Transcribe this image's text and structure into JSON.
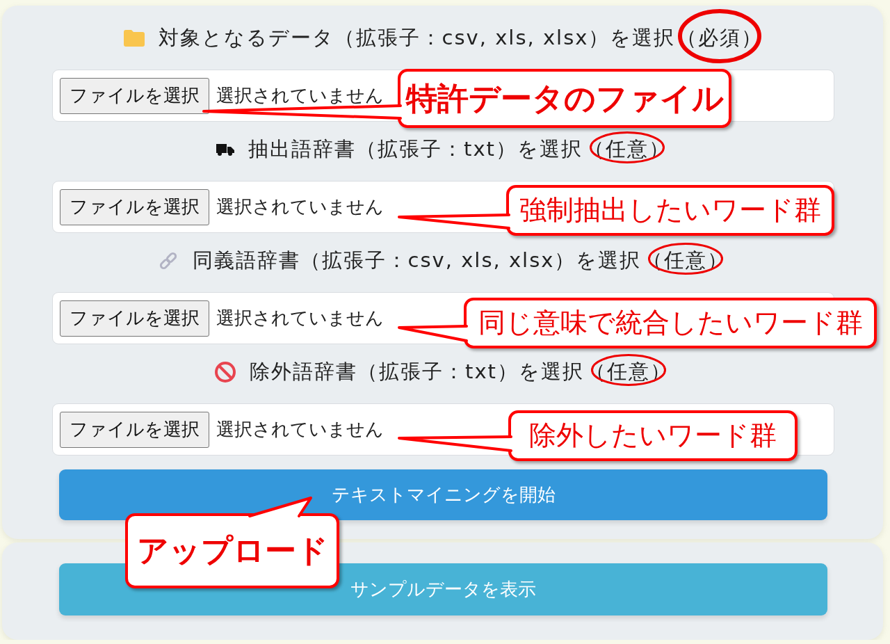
{
  "sections": [
    {
      "kind": "folder",
      "label": "対象となるデータ（拡張子：csv, xls, xlsx）を選択",
      "requirement": "（必須）",
      "circled": true,
      "file_button": "ファイルを選択",
      "file_status": "選択されていません",
      "callout": {
        "text": "特許データのファイル",
        "bold": true
      }
    },
    {
      "kind": "truck",
      "label": "抽出語辞書（拡張子：txt）を選択",
      "requirement": "（任意）",
      "circled": true,
      "file_button": "ファイルを選択",
      "file_status": "選択されていません",
      "callout": {
        "text": "強制抽出したいワード群",
        "bold": false
      }
    },
    {
      "kind": "link",
      "label": "同義語辞書（拡張子：csv, xls, xlsx）を選択",
      "requirement": "（任意）",
      "circled": true,
      "file_button": "ファイルを選択",
      "file_status": "選択されていません",
      "callout": {
        "text": "同じ意味で統合したいワード群",
        "bold": false
      }
    },
    {
      "kind": "prohibited",
      "label": "除外語辞書（拡張子：txt）を選択",
      "requirement": "（任意）",
      "circled": true,
      "file_button": "ファイルを選択",
      "file_status": "選択されていません",
      "callout": {
        "text": "除外したいワード群",
        "bold": false
      }
    }
  ],
  "start_button": {
    "label": "テキストマイニングを開始",
    "callout": {
      "text": "アップロード",
      "bold": true
    }
  },
  "sample_button": {
    "label": "サンプルデータを表示"
  }
}
